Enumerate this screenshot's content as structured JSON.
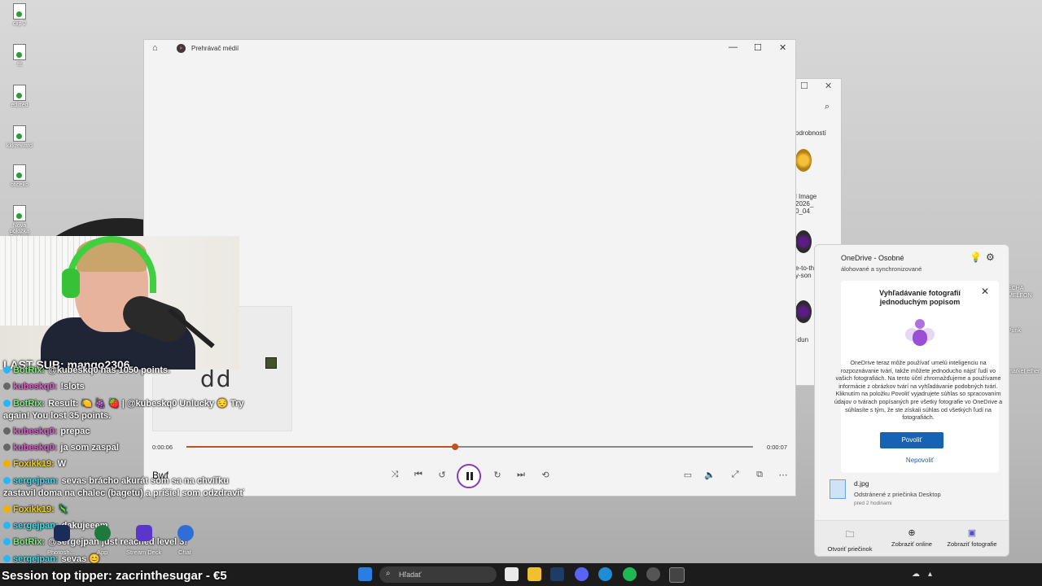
{
  "desktop": {
    "icons": [
      {
        "label": "clip 2"
      },
      {
        "label": "ttt"
      },
      {
        "label": "editted"
      },
      {
        "label": "kkkreward"
      },
      {
        "label": "oficeko"
      },
      {
        "label": "Nová položka Textový dok..."
      }
    ],
    "right_icons": [
      {
        "label": "ECHA MELEON"
      },
      {
        "label": "Punk"
      },
      {
        "label": "market ether"
      }
    ]
  },
  "media_player": {
    "title": "Prehrávač médií",
    "current_time": "0:00:06",
    "total_time": "0:00:07",
    "progress": 0.474,
    "song_title": "Bwf",
    "album_glyph": "dd",
    "accent": "#c4501e",
    "play_ring_color": "#8a3ab8"
  },
  "explorer": {
    "tab_label": "odrobností",
    "items": [
      {
        "label": "l Image 2026_ 0_04"
      },
      {
        "label": "e-to-the- y-son"
      },
      {
        "label": "-dun"
      }
    ]
  },
  "onedrive": {
    "title": "OneDrive - Osobné",
    "subtitle": "álohované a synchronizované",
    "card_title": "Vyhľadávanie fotografií jednoduchým popisom",
    "card_body": "OneDrive teraz môže používať umelú inteligenciu na rozpoznávanie tvárí, takže môžete jednoducho nájsť ľudí vo vašich fotografiách. Na tento účel zhromažďujeme a používame informácie z obrázkov tvárí na vyhľadávanie podobných tvárí. Kliknutím na položku Povoliť vyjadrujete súhlas so spracovaním údajov o tvárach popísaných pre všetky fotografie vo OneDrive a súhlasíte s tým, že ste získali súhlas od všetkých ľudí na fotografiách.",
    "allow_label": "Povoliť",
    "deny_label": "Nepovoliť",
    "file_name": "d.jpg",
    "file_desc": "Odstránené z priečinka Desktop",
    "file_time": "pred 2 hodinami",
    "footer": {
      "open_folder": "Otvoriť priečinok",
      "view_online": "Zobraziť online",
      "view_photos": "Zobraziť fotografie"
    },
    "accent": "#1663b6"
  },
  "stream": {
    "last_sub": "LAST SUB: mango2306",
    "session_tipper": "Session top tipper: zacrinthesugar - €5"
  },
  "chat": [
    {
      "user": "BotRix:",
      "text": "@kubeskq0 has 1050 points.",
      "color": "#7cf07c"
    },
    {
      "user": "kubeskq0:",
      "text": "!slots",
      "color": "#e060d0"
    },
    {
      "user": "BotRix:",
      "text": "Result: 🍋 🍇 🍓 | @kubeskq0 Unlucky 😔 Try again! You lost 35 points.",
      "color": "#7cf07c"
    },
    {
      "user": "kubeskq0:",
      "text": "prepac",
      "color": "#e060d0"
    },
    {
      "user": "kubeskq0:",
      "text": "ja som zaspal",
      "color": "#e060d0"
    },
    {
      "user": "Foxikk19:",
      "text": "W",
      "color": "#f0d020"
    },
    {
      "user": "sergejpan:",
      "text": "sevas brácho akurát som sa na chvíľku zastavil doma na chalec (bagetu) a prišiel som odzdraviť",
      "color": "#40e0f0"
    },
    {
      "user": "Foxikk19:",
      "text": "🦎",
      "color": "#f0d020"
    },
    {
      "user": "sergejpan:",
      "text": "dakujeeem",
      "color": "#40e0f0"
    },
    {
      "user": "BotRix:",
      "text": "@sergejpan just reached level 3!",
      "color": "#7cf07c"
    },
    {
      "user": "sergejpan:",
      "text": "sevas 😊",
      "color": "#40e0f0"
    }
  ],
  "dock_labels": {
    "photoshop": "Photosh...",
    "app": "App",
    "stream_deck": "Stream Deck",
    "generic": "Chat"
  },
  "taskbar": {
    "search_placeholder": "Hľadať"
  }
}
